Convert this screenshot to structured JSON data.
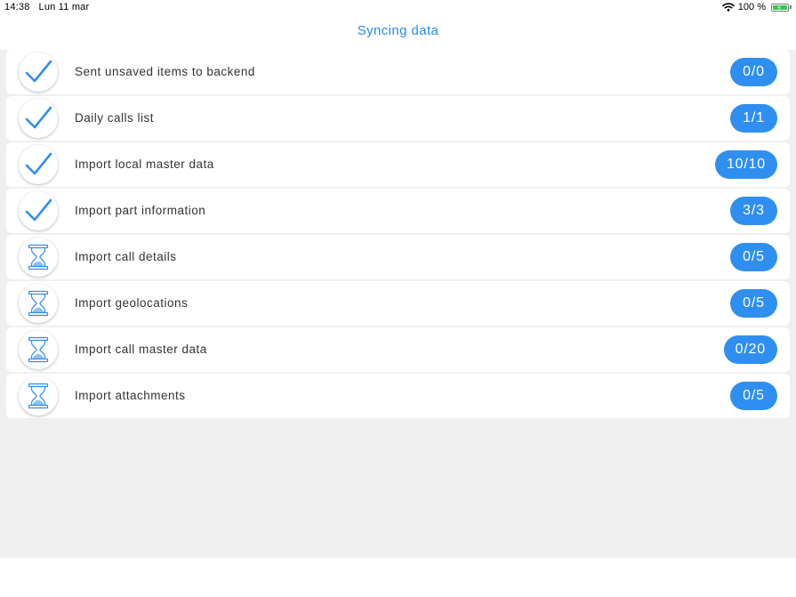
{
  "status_bar": {
    "time": "14:38",
    "date": "Lun 11 mar",
    "battery_text": "100 %",
    "battery_level": 1.0
  },
  "title": "Syncing data",
  "colors": {
    "accent": "#2f8ff0",
    "title": "#2a8de5",
    "background": "#efefef"
  },
  "items": [
    {
      "label": "Sent unsaved items to backend",
      "count": "0/0",
      "icon": "check-icon"
    },
    {
      "label": "Daily calls list",
      "count": "1/1",
      "icon": "check-icon"
    },
    {
      "label": "Import local master data",
      "count": "10/10",
      "icon": "check-icon"
    },
    {
      "label": "Import part information",
      "count": "3/3",
      "icon": "check-icon"
    },
    {
      "label": "Import call details",
      "count": "0/5",
      "icon": "hourglass-icon"
    },
    {
      "label": "Import geolocations",
      "count": "0/5",
      "icon": "hourglass-icon"
    },
    {
      "label": "Import call master data",
      "count": "0/20",
      "icon": "hourglass-icon"
    },
    {
      "label": "Import attachments",
      "count": "0/5",
      "icon": "hourglass-icon"
    }
  ]
}
